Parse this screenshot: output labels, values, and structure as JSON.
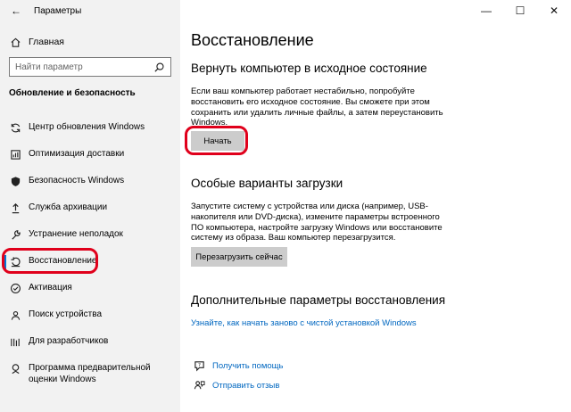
{
  "window": {
    "title": "Параметры",
    "controls": {
      "minimize": "—",
      "maximize": "☐",
      "close": "✕"
    }
  },
  "sidebar": {
    "home_label": "Главная",
    "search_placeholder": "Найти параметр",
    "section_title": "Обновление и безопасность",
    "items": [
      {
        "label": "Центр обновления Windows",
        "icon": "sync-icon"
      },
      {
        "label": "Оптимизация доставки",
        "icon": "delivery-icon"
      },
      {
        "label": "Безопасность Windows",
        "icon": "shield-icon"
      },
      {
        "label": "Служба архивации",
        "icon": "backup-arrow-icon"
      },
      {
        "label": "Устранение неполадок",
        "icon": "wrench-icon"
      },
      {
        "label": "Восстановление",
        "icon": "recovery-icon",
        "selected": true
      },
      {
        "label": "Активация",
        "icon": "check-circle-icon"
      },
      {
        "label": "Поиск устройства",
        "icon": "person-pin-icon"
      },
      {
        "label": "Для разработчиков",
        "icon": "developer-icon"
      },
      {
        "label": "Программа предварительной оценки Windows",
        "icon": "insider-icon"
      }
    ]
  },
  "main": {
    "title": "Восстановление",
    "reset": {
      "heading": "Вернуть компьютер в исходное состояние",
      "text": "Если ваш компьютер работает нестабильно, попробуйте восстановить его исходное состояние. Вы сможете при этом сохранить или удалить личные файлы, а затем переустановить Windows.",
      "button": "Начать"
    },
    "advanced": {
      "heading": "Особые варианты загрузки",
      "text": "Запустите систему с устройства или диска (например, USB-накопителя или DVD-диска), измените параметры встроенного ПО компьютера, настройте загрузку Windows или восстановите систему из образа. Ваш компьютер перезагрузится.",
      "button": "Перезагрузить сейчас"
    },
    "more": {
      "heading": "Дополнительные параметры восстановления",
      "link": "Узнайте, как начать заново с чистой установкой Windows"
    },
    "help": {
      "get_help": "Получить помощь",
      "feedback": "Отправить отзыв"
    }
  },
  "colors": {
    "accent": "#0078d7",
    "link": "#0067c0",
    "highlight": "#e0001b",
    "sidebar_bg": "#f2f2f2",
    "button_bg": "#cccccc"
  }
}
